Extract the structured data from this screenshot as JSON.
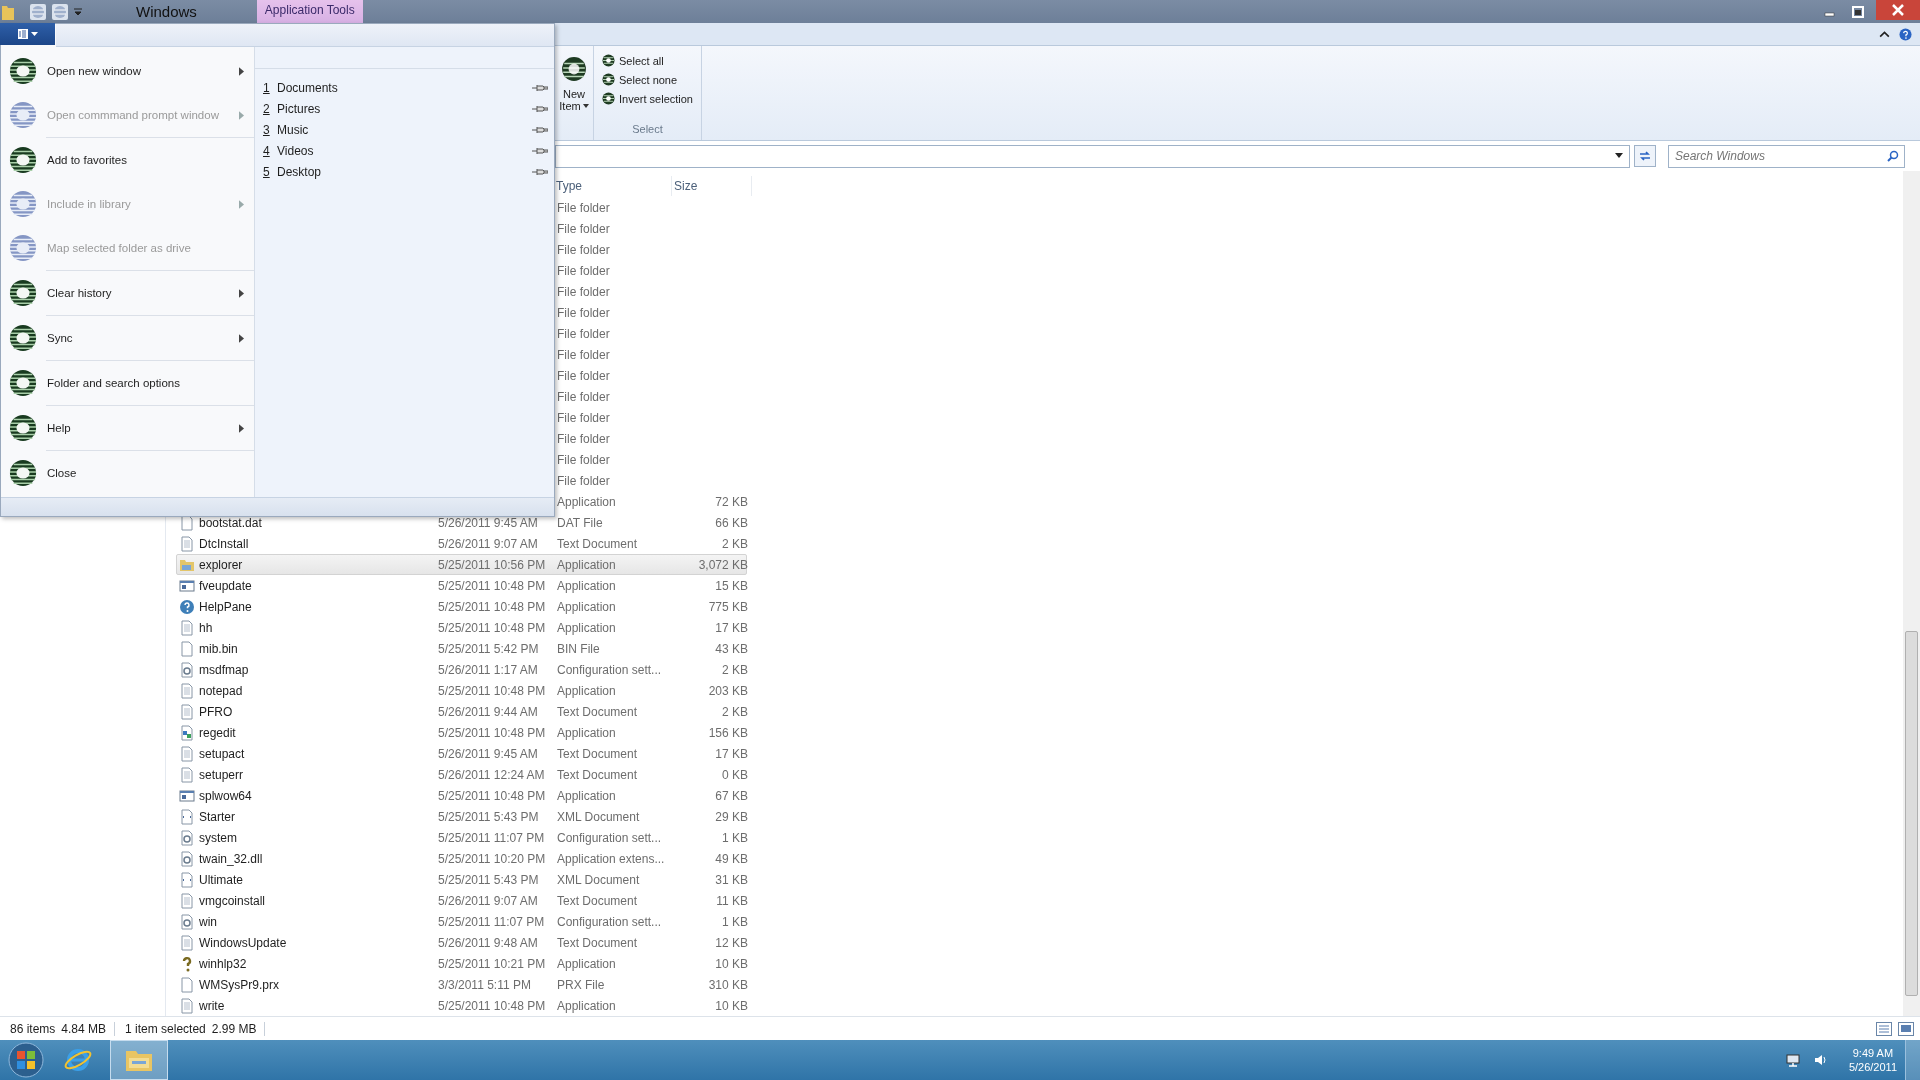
{
  "title_bar": {
    "title": "Windows",
    "context_tab": "Application Tools"
  },
  "file_menu": {
    "items": [
      {
        "label": "Open new window",
        "disabled": false,
        "submenu": true,
        "separator_before": false
      },
      {
        "label": "Open commmand prompt window",
        "disabled": true,
        "submenu": true,
        "separator_before": false
      },
      {
        "label": "Add to favorites",
        "disabled": false,
        "submenu": false,
        "separator_before": true
      },
      {
        "label": "Include in library",
        "disabled": true,
        "submenu": true,
        "separator_before": false
      },
      {
        "label": "Map selected folder as drive",
        "disabled": true,
        "submenu": false,
        "separator_before": false
      },
      {
        "label": "Clear history",
        "disabled": false,
        "submenu": true,
        "separator_before": true
      },
      {
        "label": "Sync",
        "disabled": false,
        "submenu": true,
        "separator_before": true
      },
      {
        "label": "Folder and search options",
        "disabled": false,
        "submenu": false,
        "separator_before": true
      },
      {
        "label": "Help",
        "disabled": false,
        "submenu": true,
        "separator_before": true
      },
      {
        "label": "Close",
        "disabled": false,
        "submenu": false,
        "separator_before": true
      }
    ],
    "recent_places": [
      {
        "number": "1",
        "label": "Documents"
      },
      {
        "number": "2",
        "label": "Pictures"
      },
      {
        "number": "3",
        "label": "Music"
      },
      {
        "number": "4",
        "label": "Videos"
      },
      {
        "number": "5",
        "label": "Desktop"
      }
    ]
  },
  "ribbon": {
    "new_item": {
      "line1": "New",
      "line2": "Item"
    },
    "select_group": {
      "label": "Select",
      "commands": [
        "Select all",
        "Select none",
        "Invert selection"
      ]
    }
  },
  "search": {
    "placeholder": "Search Windows"
  },
  "file_list": {
    "columns": [
      "Type",
      "Size"
    ],
    "rows": [
      {
        "type": "File folder",
        "selected": false
      },
      {
        "type": "File folder",
        "selected": false
      },
      {
        "type": "File folder",
        "selected": false
      },
      {
        "type": "File folder",
        "selected": false
      },
      {
        "type": "File folder",
        "selected": false
      },
      {
        "type": "File folder",
        "selected": false
      },
      {
        "type": "File folder",
        "selected": false
      },
      {
        "type": "File folder",
        "selected": false
      },
      {
        "type": "File folder",
        "selected": false
      },
      {
        "type": "File folder",
        "selected": false
      },
      {
        "type": "File folder",
        "selected": false
      },
      {
        "type": "File folder",
        "selected": false
      },
      {
        "type": "File folder",
        "selected": false
      },
      {
        "type": "File folder",
        "selected": false
      },
      {
        "type": "Application",
        "size": "72 KB",
        "selected": false
      },
      {
        "kind": "blank",
        "name": "bootstat.dat",
        "date": "5/26/2011 9:45 AM",
        "type": "DAT File",
        "size": "66 KB",
        "selected": false
      },
      {
        "kind": "text",
        "name": "DtcInstall",
        "date": "5/26/2011 9:07 AM",
        "type": "Text Document",
        "size": "2 KB",
        "selected": false
      },
      {
        "kind": "explorer",
        "name": "explorer",
        "date": "5/25/2011 10:56 PM",
        "type": "Application",
        "size": "3,072 KB",
        "selected": true
      },
      {
        "kind": "window",
        "name": "fveupdate",
        "date": "5/25/2011 10:48 PM",
        "type": "Application",
        "size": "15 KB",
        "selected": false
      },
      {
        "kind": "help",
        "name": "HelpPane",
        "date": "5/25/2011 10:48 PM",
        "type": "Application",
        "size": "775 KB",
        "selected": false
      },
      {
        "kind": "hh",
        "name": "hh",
        "date": "5/25/2011 10:48 PM",
        "type": "Application",
        "size": "17 KB",
        "selected": false
      },
      {
        "kind": "blank",
        "name": "mib.bin",
        "date": "5/25/2011 5:42 PM",
        "type": "BIN File",
        "size": "43 KB",
        "selected": false
      },
      {
        "kind": "gear",
        "name": "msdfmap",
        "date": "5/26/2011 1:17 AM",
        "type": "Configuration sett...",
        "size": "2 KB",
        "selected": false
      },
      {
        "kind": "notepad",
        "name": "notepad",
        "date": "5/25/2011 10:48 PM",
        "type": "Application",
        "size": "203 KB",
        "selected": false
      },
      {
        "kind": "text",
        "name": "PFRO",
        "date": "5/26/2011 9:44 AM",
        "type": "Text Document",
        "size": "2 KB",
        "selected": false
      },
      {
        "kind": "regedit",
        "name": "regedit",
        "date": "5/25/2011 10:48 PM",
        "type": "Application",
        "size": "156 KB",
        "selected": false
      },
      {
        "kind": "text",
        "name": "setupact",
        "date": "5/26/2011 9:45 AM",
        "type": "Text Document",
        "size": "17 KB",
        "selected": false
      },
      {
        "kind": "text",
        "name": "setuperr",
        "date": "5/26/2011 12:24 AM",
        "type": "Text Document",
        "size": "0 KB",
        "selected": false
      },
      {
        "kind": "window",
        "name": "splwow64",
        "date": "5/25/2011 10:48 PM",
        "type": "Application",
        "size": "67 KB",
        "selected": false
      },
      {
        "kind": "xml",
        "name": "Starter",
        "date": "5/25/2011 5:43 PM",
        "type": "XML Document",
        "size": "29 KB",
        "selected": false
      },
      {
        "kind": "gear",
        "name": "system",
        "date": "5/25/2011 11:07 PM",
        "type": "Configuration sett...",
        "size": "1 KB",
        "selected": false
      },
      {
        "kind": "dll",
        "name": "twain_32.dll",
        "date": "5/25/2011 10:20 PM",
        "type": "Application extens...",
        "size": "49 KB",
        "selected": false
      },
      {
        "kind": "xml",
        "name": "Ultimate",
        "date": "5/25/2011 5:43 PM",
        "type": "XML Document",
        "size": "31 KB",
        "selected": false
      },
      {
        "kind": "text",
        "name": "vmgcoinstall",
        "date": "5/26/2011 9:07 AM",
        "type": "Text Document",
        "size": "11 KB",
        "selected": false
      },
      {
        "kind": "gear",
        "name": "win",
        "date": "5/25/2011 11:07 PM",
        "type": "Configuration sett...",
        "size": "1 KB",
        "selected": false
      },
      {
        "kind": "text",
        "name": "WindowsUpdate",
        "date": "5/26/2011 9:48 AM",
        "type": "Text Document",
        "size": "12 KB",
        "selected": false
      },
      {
        "kind": "question",
        "name": "winhlp32",
        "date": "5/25/2011 10:21 PM",
        "type": "Application",
        "size": "10 KB",
        "selected": false
      },
      {
        "kind": "blank",
        "name": "WMSysPr9.prx",
        "date": "3/3/2011 5:11 PM",
        "type": "PRX File",
        "size": "310 KB",
        "selected": false
      },
      {
        "kind": "write",
        "name": "write",
        "date": "5/25/2011 10:48 PM",
        "type": "Application",
        "size": "10 KB",
        "selected": false
      }
    ]
  },
  "status_bar": {
    "groups": [
      [
        "86 items",
        "4.84 MB"
      ],
      [
        "1 item selected",
        "2.99 MB"
      ]
    ]
  },
  "taskbar": {
    "apps": [
      {
        "kind": "ie",
        "selected": false
      },
      {
        "kind": "explorer",
        "selected": true
      }
    ],
    "time": "9:49 AM",
    "date": "5/26/2011"
  }
}
